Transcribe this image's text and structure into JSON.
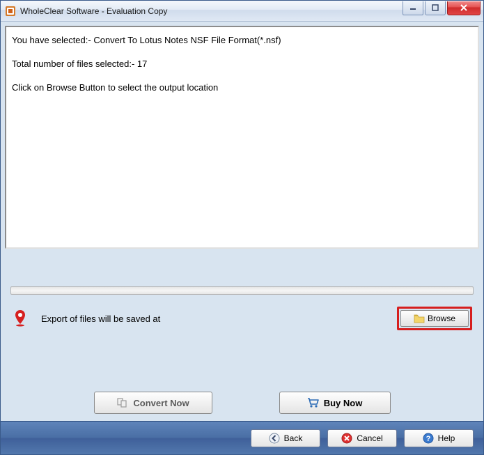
{
  "window": {
    "title": "WholeClear Software - Evaluation Copy"
  },
  "main": {
    "line1": "You have selected:- Convert To Lotus Notes NSF File Format(*.nsf)",
    "line2": "Total number of files selected:- 17",
    "line3": "Click on Browse Button to select the output location"
  },
  "export": {
    "label": "Export of files will be saved at",
    "browse": "Browse"
  },
  "actions": {
    "convert": "Convert Now",
    "buy": "Buy Now"
  },
  "footer": {
    "back": "Back",
    "cancel": "Cancel",
    "help": "Help"
  }
}
